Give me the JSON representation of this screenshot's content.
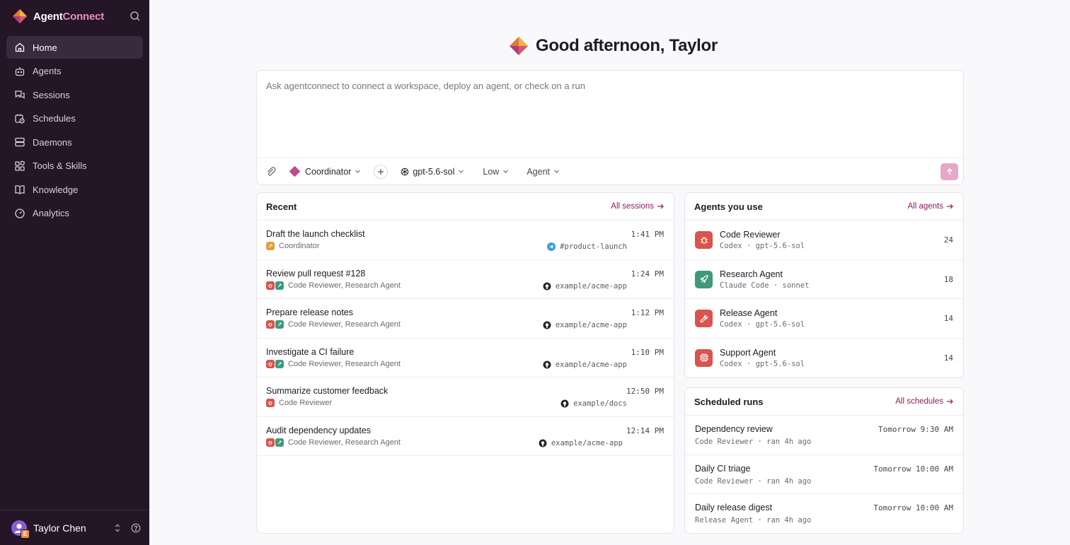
{
  "brand": {
    "name_primary": "Agent",
    "name_accent": "Connect"
  },
  "sidebar": {
    "items": [
      {
        "label": "Home",
        "icon": "home-icon",
        "active": true
      },
      {
        "label": "Agents",
        "icon": "robot-icon"
      },
      {
        "label": "Sessions",
        "icon": "chat-icon"
      },
      {
        "label": "Schedules",
        "icon": "calendar-clock-icon"
      },
      {
        "label": "Daemons",
        "icon": "server-icon"
      },
      {
        "label": "Tools & Skills",
        "icon": "blocks-icon"
      },
      {
        "label": "Knowledge",
        "icon": "book-icon"
      },
      {
        "label": "Analytics",
        "icon": "gauge-icon"
      }
    ],
    "user": {
      "name": "Taylor Chen",
      "badge": "E"
    }
  },
  "greeting": "Good afternoon, Taylor",
  "composer": {
    "placeholder": "Ask agentconnect to connect a workspace, deploy an agent, or check on a run",
    "agent": "Coordinator",
    "model": "gpt-5.6-sol",
    "effort": "Low",
    "mode": "Agent"
  },
  "recent": {
    "title": "Recent",
    "link": "All sessions",
    "rows": [
      {
        "title": "Draft the launch checklist",
        "time": "1:41 PM",
        "agents": "Coordinator",
        "tag": "#product-launch"
      },
      {
        "title": "Review pull request #128",
        "time": "1:24 PM",
        "agents": "Code Reviewer, Research Agent",
        "tag": "example/acme-app"
      },
      {
        "title": "Prepare release notes",
        "time": "1:12 PM",
        "agents": "Code Reviewer, Research Agent",
        "tag": "example/acme-app"
      },
      {
        "title": "Investigate a CI failure",
        "time": "1:10 PM",
        "agents": "Code Reviewer, Research Agent",
        "tag": "example/acme-app"
      },
      {
        "title": "Summarize customer feedback",
        "time": "12:50 PM",
        "agents": "Code Reviewer",
        "tag": "example/docs"
      },
      {
        "title": "Audit dependency updates",
        "time": "12:14 PM",
        "agents": "Code Reviewer, Research Agent",
        "tag": "example/acme-app"
      }
    ]
  },
  "agents": {
    "title": "Agents you use",
    "link": "All agents",
    "rows": [
      {
        "name": "Code Reviewer",
        "sub": "Codex · gpt-5.6-sol",
        "count": "24",
        "icon": "bug-icon",
        "color": "#d9534f"
      },
      {
        "name": "Research Agent",
        "sub": "Claude Code · sonnet",
        "count": "18",
        "icon": "rocket-icon",
        "color": "#3f9a7a"
      },
      {
        "name": "Release Agent",
        "sub": "Codex · gpt-5.6-sol",
        "count": "14",
        "icon": "wrench-icon",
        "color": "#d9534f"
      },
      {
        "name": "Support Agent",
        "sub": "Codex · gpt-5.6-sol",
        "count": "14",
        "icon": "chip-icon",
        "color": "#d9534f"
      }
    ]
  },
  "scheduled": {
    "title": "Scheduled runs",
    "link": "All schedules",
    "rows": [
      {
        "name": "Dependency review",
        "time": "Tomorrow 9:30 AM",
        "sub": "Code Reviewer · ran 4h ago"
      },
      {
        "name": "Daily CI triage",
        "time": "Tomorrow 10:00 AM",
        "sub": "Code Reviewer · ran 4h ago"
      },
      {
        "name": "Daily release digest",
        "time": "Tomorrow 10:00 AM",
        "sub": "Release Agent · ran 4h ago"
      }
    ]
  },
  "colors": {
    "accent": "#8b1d5a",
    "sidebar_bg": "#241527",
    "send_button": "#e4a9c7"
  }
}
